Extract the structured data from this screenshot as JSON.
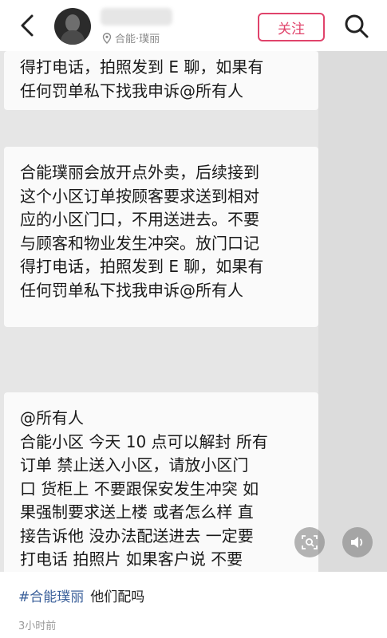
{
  "header": {
    "location": "合能·璞丽",
    "follow_label": "关注"
  },
  "post": {
    "bubble1_lines": [
      "得打电话，拍照发到 E 聊，如果有",
      "任何罚单私下找我申诉@所有人"
    ],
    "bubble2_lines": [
      "合能璞丽会放开点外卖，后续接到",
      "这个小区订单按顾客要求送到相对",
      "应的小区门口，不用送进去。不要",
      "与顾客和物业发生冲突。放门口记",
      "得打电话，拍照发到 E 聊，如果有",
      "任何罚单私下找我申诉@所有人"
    ],
    "bubble3_lines": [
      "@所有人",
      "合能小区 今天 10 点可以解封 所有",
      "订单 禁止送入小区，请放小区门",
      "口 货柜上 不要跟保安发生冲突 如",
      "果强制要求送上楼 或者怎么样 直",
      "接告诉他 没办法配送进去 一定要",
      "打电话 拍照片 如果客户说 不要"
    ],
    "hashtag": "#合能璞丽",
    "caption_text": "他们配吗",
    "time": "3小时前"
  },
  "icons": {
    "back": "back-arrow-icon",
    "location": "location-pin-icon",
    "search": "search-icon",
    "image_search": "image-search-icon",
    "sound": "speaker-icon"
  },
  "colors": {
    "follow_accent": "#e0436b",
    "hashtag": "#3a5f9a"
  }
}
